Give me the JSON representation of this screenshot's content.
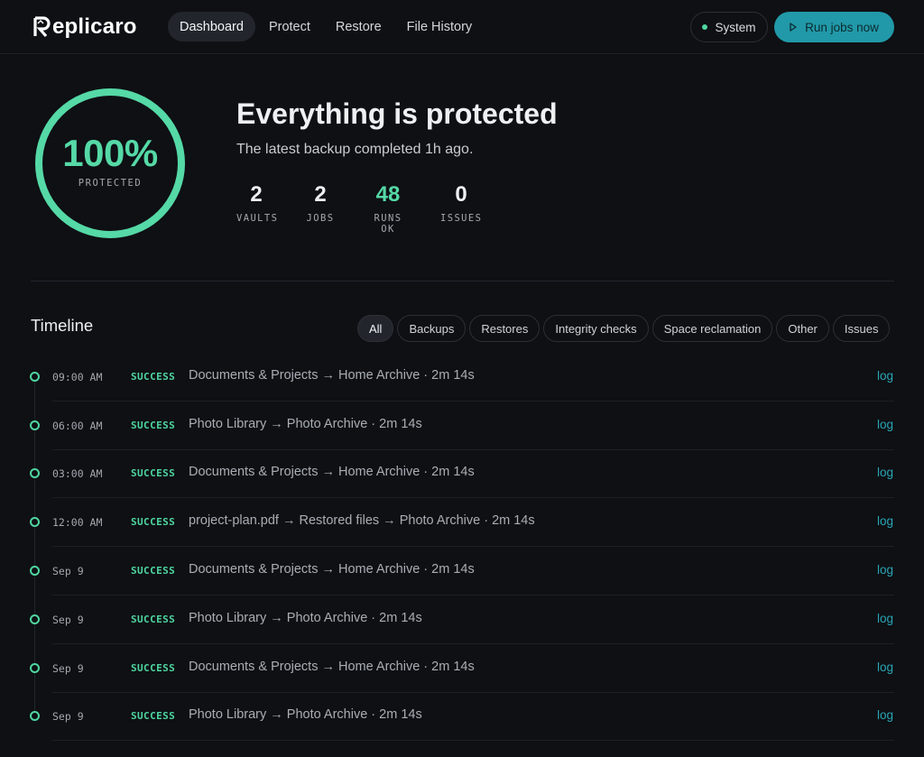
{
  "app": {
    "name": "Replicaro"
  },
  "nav": {
    "items": [
      "Dashboard",
      "Protect",
      "Restore",
      "File History"
    ],
    "active": 0
  },
  "header": {
    "system_label": "System",
    "run_label": "Run jobs now"
  },
  "hero": {
    "percent": "100%",
    "percent_value": 100,
    "percent_label": "PROTECTED",
    "title": "Everything is protected",
    "subtitle": "The latest backup completed 1h ago.",
    "stats": [
      {
        "value": "2",
        "label": "VAULTS"
      },
      {
        "value": "2",
        "label": "JOBS"
      },
      {
        "value": "48",
        "label": "RUNS OK"
      },
      {
        "value": "0",
        "label": "ISSUES"
      }
    ]
  },
  "timeline": {
    "title": "Timeline",
    "filters": [
      "All",
      "Backups",
      "Restores",
      "Integrity checks",
      "Space reclamation",
      "Other",
      "Issues"
    ],
    "active_filter": 0,
    "entries": [
      {
        "time": "09:00 AM",
        "status": "SUCCESS",
        "description": "Documents & Projects → Home Archive · 2m 14s",
        "link": "log"
      },
      {
        "time": "06:00 AM",
        "status": "SUCCESS",
        "description": "Photo Library → Photo Archive · 2m 14s",
        "link": "log"
      },
      {
        "time": "03:00 AM",
        "status": "SUCCESS",
        "description": "Documents & Projects → Home Archive · 2m 14s",
        "link": "log"
      },
      {
        "time": "12:00 AM",
        "status": "SUCCESS",
        "description": "project-plan.pdf → Restored files → Photo Archive · 2m 14s",
        "link": "log"
      },
      {
        "time": "Sep 9",
        "status": "SUCCESS",
        "description": "Documents & Projects → Home Archive · 2m 14s",
        "link": "log"
      },
      {
        "time": "Sep 9",
        "status": "SUCCESS",
        "description": "Photo Library → Photo Archive · 2m 14s",
        "link": "log"
      },
      {
        "time": "Sep 9",
        "status": "SUCCESS",
        "description": "Documents & Projects → Home Archive · 2m 14s",
        "link": "log"
      },
      {
        "time": "Sep 9",
        "status": "SUCCESS",
        "description": "Photo Library → Photo Archive · 2m 14s",
        "link": "log"
      }
    ]
  },
  "colors": {
    "accent": "#55d9a6",
    "brand": "#2199a8",
    "background": "#0e1014"
  }
}
